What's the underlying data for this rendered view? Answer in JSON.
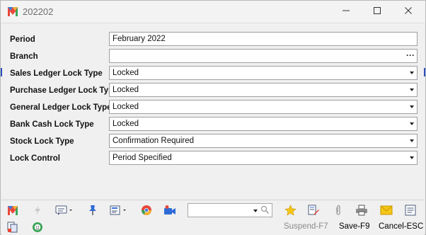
{
  "window": {
    "title": "202202",
    "app_icon": "app-logo-icon",
    "controls": [
      "minimize-icon",
      "maximize-icon",
      "close-icon"
    ]
  },
  "form": {
    "fields": [
      {
        "label": "Period",
        "value": "February 2022",
        "kind": "text"
      },
      {
        "label": "Branch",
        "value": "",
        "kind": "lookup"
      },
      {
        "label": "Sales Ledger Lock Type",
        "value": "Locked",
        "kind": "dropdown"
      },
      {
        "label": "Purchase Ledger Lock Type",
        "value": "Locked",
        "kind": "dropdown"
      },
      {
        "label": "General Ledger Lock Type",
        "value": "Locked",
        "kind": "dropdown"
      },
      {
        "label": "Bank Cash Lock Type",
        "value": "Locked",
        "kind": "dropdown"
      },
      {
        "label": "Stock Lock Type",
        "value": "Confirmation Required",
        "kind": "dropdown"
      },
      {
        "label": "Lock Control",
        "value": "Period Specified",
        "kind": "dropdown"
      }
    ],
    "lookup_ellipsis": "···"
  },
  "toolbar": {
    "search": {
      "value": ""
    },
    "actions": {
      "suspend": "Suspend-F7",
      "save": "Save-F9",
      "cancel": "Cancel-ESC"
    }
  },
  "colors": {
    "window_bg": "#f0f0f0",
    "field_border": "#9f9f9f",
    "disabled_text": "#8a8a8a",
    "accent_blue": "#2a52be"
  }
}
